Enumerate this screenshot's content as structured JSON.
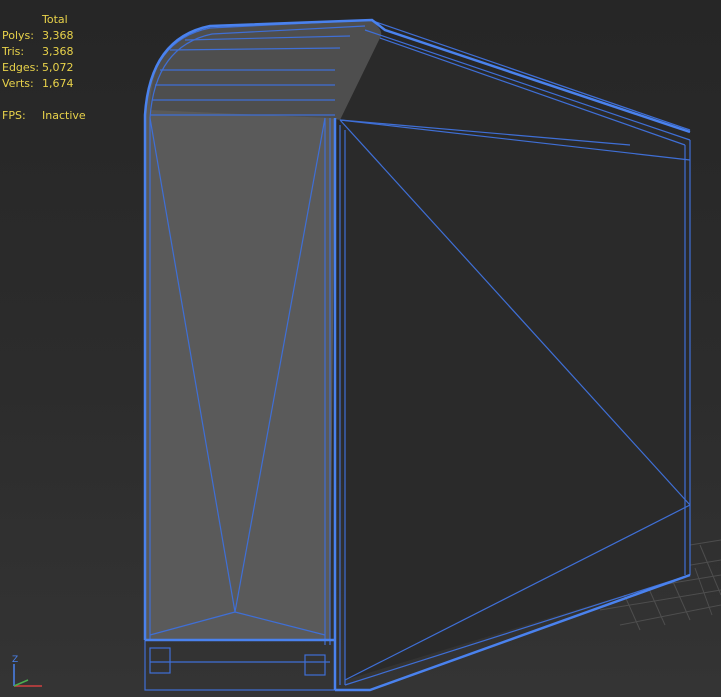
{
  "viewport": {
    "stats": {
      "header": "Total",
      "polys_label": "Polys:",
      "polys_value": "3,368",
      "tris_label": "Tris:",
      "tris_value": "3,368",
      "edges_label": "Edges:",
      "edges_value": "5,072",
      "verts_label": "Verts:",
      "verts_value": "1,674",
      "fps_label": "FPS:",
      "fps_value": "Inactive"
    },
    "gizmo": {
      "z_label": "Z",
      "icon": "axis-tripod-icon"
    },
    "colors": {
      "wire": "#3f6fd6",
      "wire_bright": "#4a82ee",
      "stats_text": "#e8d24a",
      "face_light": "#595959",
      "face_dark": "#2a2a2a",
      "grid": "#555555"
    }
  }
}
